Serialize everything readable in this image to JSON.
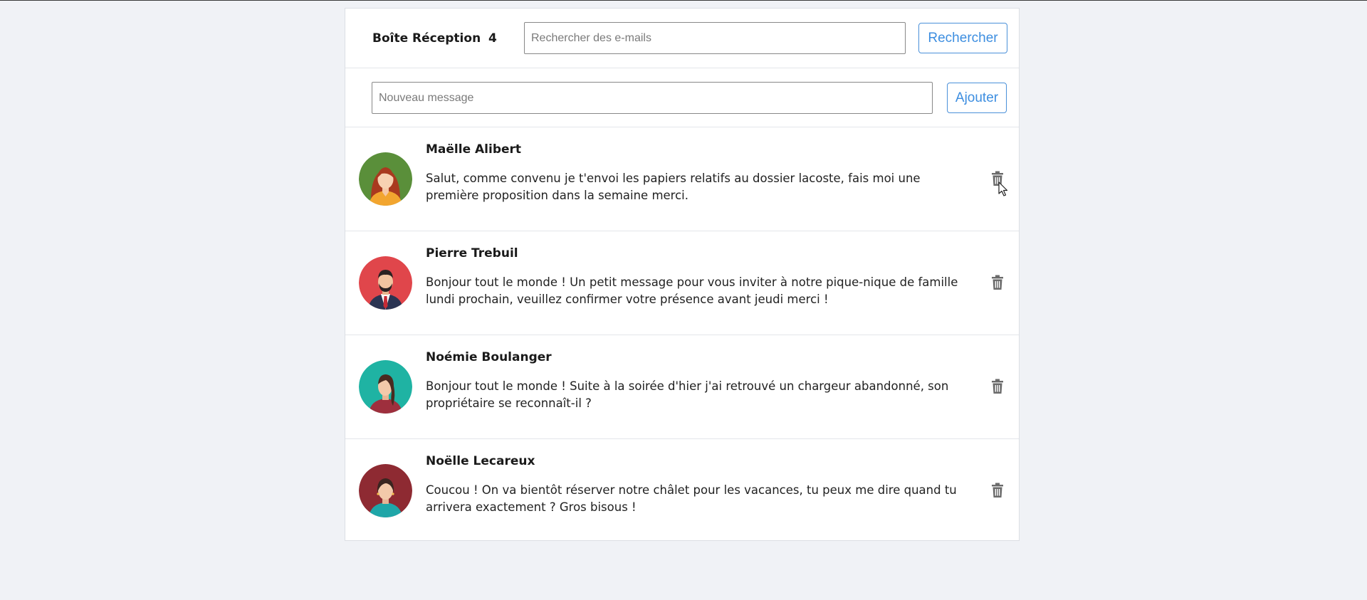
{
  "header": {
    "title": "Boîte Réception",
    "count": "4",
    "search_placeholder": "Rechercher des e-mails",
    "search_value": "",
    "search_button": "Rechercher"
  },
  "compose": {
    "message_placeholder": "Nouveau message",
    "message_value": "",
    "add_button": "Ajouter"
  },
  "emails": [
    {
      "sender": "Maëlle Alibert",
      "preview": "Salut, comme convenu je t'envoi les papiers relatifs au dossier lacoste, fais moi une première proposition dans la semaine merci.",
      "avatar_color": "#5a8f3a"
    },
    {
      "sender": "Pierre Trebuil",
      "preview": "Bonjour tout le monde ! Un petit message pour vous inviter à notre pique-nique de famille lundi prochain, veuillez confirmer votre présence avant jeudi merci !",
      "avatar_color": "#e0464b"
    },
    {
      "sender": "Noémie Boulanger",
      "preview": "Bonjour tout le monde ! Suite à la soirée d'hier j'ai retrouvé un chargeur abandonné, son propriétaire se reconnaît-il ?",
      "avatar_color": "#1fb3a3"
    },
    {
      "sender": "Noëlle Lecareux",
      "preview": "Coucou ! On va bientôt réserver notre châlet pour les vacances, tu peux me dire quand tu arrivera exactement ? Gros bisous !",
      "avatar_color": "#8e2a32"
    }
  ],
  "icons": {
    "delete": "trash-icon"
  },
  "colors": {
    "accent": "#3d8ee0",
    "background": "#f0f2f6"
  }
}
